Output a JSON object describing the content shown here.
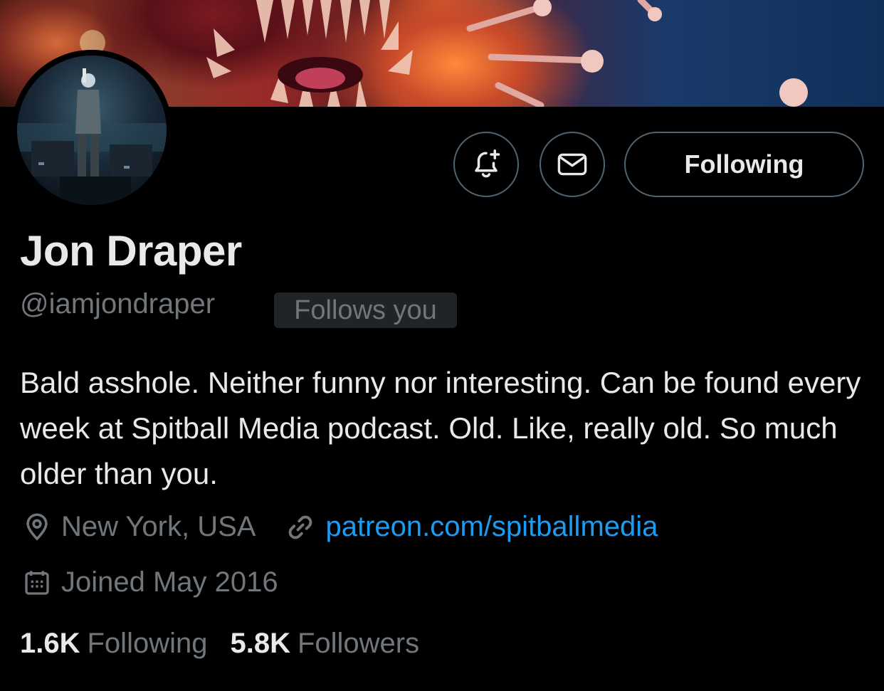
{
  "profile": {
    "name": "Jon Draper",
    "handle": "@iamjondraper",
    "follows_you": "Follows you",
    "bio": "Bald asshole. Neither funny nor interesting. Can be found every week at Spitball Media podcast. Old. Like, really old. So much older than you.",
    "location": "New York, USA",
    "website": "patreon.com/spitballmedia",
    "joined": "Joined May 2016"
  },
  "actions": {
    "follow_label": "Following",
    "notify_icon": "bell-plus-icon",
    "message_icon": "envelope-icon"
  },
  "stats": {
    "following_count": "1.6K",
    "following_label": "Following",
    "followers_count": "5.8K",
    "followers_label": "Followers"
  },
  "colors": {
    "background": "#000000",
    "text": "#e7e9ea",
    "muted": "#71767b",
    "link": "#1d9bf0",
    "border": "#536471"
  }
}
